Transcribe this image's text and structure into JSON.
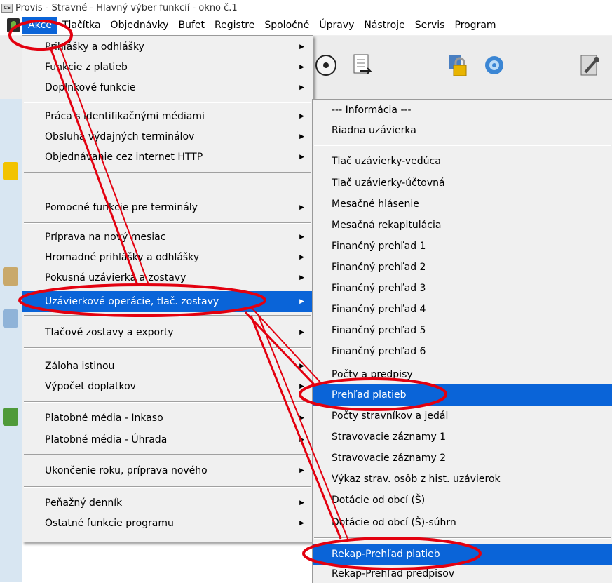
{
  "window": {
    "title": "Provis - Stravné - Hlavný výber funkcií - okno č.1",
    "app_icon_text": "CS"
  },
  "menubar": {
    "items": [
      "Akce",
      "Tlačítka",
      "Objednávky",
      "Bufet",
      "Registre",
      "Spoločné",
      "Úpravy",
      "Nástroje",
      "Servis",
      "Program"
    ],
    "active": "Akce"
  },
  "akce_menu": {
    "items": [
      "Prihlášky a odhlášky",
      "Funkcie z platieb",
      "Doplnkové funkcie",
      "Práca s identifikačnými médiami",
      "Obsluha výdajných terminálov",
      "Objednávanie cez internet HTTP",
      "Pomocné funkcie pre terminály",
      "Príprava na nový mesiac",
      "Hromadné prihlášky a odhlášky",
      "Pokusná uzávierka a zostavy",
      "Uzávierkové operácie, tlač. zostavy",
      "Tlačové zostavy a exporty",
      "Záloha istinou",
      "Výpočet doplatkov",
      "Platobné média - Inkaso",
      "Platobné média - Úhrada",
      "Ukončenie roku, príprava nového",
      "Peňažný denník",
      "Ostatné funkcie programu"
    ],
    "selected": "Uzávierkové operácie, tlač. zostavy"
  },
  "submenu": {
    "items": [
      "--- Informácia ---",
      "Riadna uzávierka",
      "Tlač uzávierky-vedúca",
      "Tlač uzávierky-účtovná",
      "Mesačné hlásenie",
      "Mesačná rekapitulácia",
      "Finančný prehľad 1",
      "Finančný prehľad 2",
      "Finančný prehľad 3",
      "Finančný prehľad 4",
      "Finančný prehľad 5",
      "Finančný prehľad 6",
      "Počty a predpisy",
      "Prehľad platieb",
      "Počty stravníkov a jedál",
      "Stravovacie záznamy 1",
      "Stravovacie záznamy 2",
      "Výkaz strav. osôb z hist. uzávierok",
      "Dotácie od obcí (Š)",
      "Dotácie od obcí (Š)-súhrn",
      "Rekap-Prehľad platieb",
      "Rekap-Prehľad predpisov"
    ],
    "highlighted": [
      "Prehľad platieb",
      "Rekap-Prehľad platieb"
    ]
  },
  "colors": {
    "selection": "#0a64d8",
    "annotation": "#e3000f",
    "menu_bg": "#f0f0f0"
  }
}
